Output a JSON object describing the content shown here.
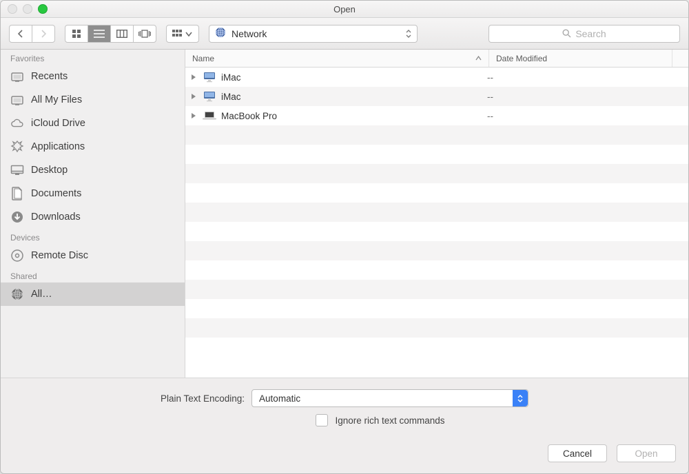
{
  "title": "Open",
  "toolbar": {
    "location_label": "Network",
    "search_placeholder": "Search"
  },
  "sidebar": {
    "groups": [
      {
        "label": "Favorites",
        "items": [
          {
            "icon": "recents-icon",
            "label": "Recents"
          },
          {
            "icon": "all-files-icon",
            "label": "All My Files"
          },
          {
            "icon": "icloud-icon",
            "label": "iCloud Drive"
          },
          {
            "icon": "applications-icon",
            "label": "Applications"
          },
          {
            "icon": "desktop-icon",
            "label": "Desktop"
          },
          {
            "icon": "documents-icon",
            "label": "Documents"
          },
          {
            "icon": "downloads-icon",
            "label": "Downloads"
          }
        ]
      },
      {
        "label": "Devices",
        "items": [
          {
            "icon": "remote-disc-icon",
            "label": "Remote Disc"
          }
        ]
      },
      {
        "label": "Shared",
        "items": [
          {
            "icon": "network-icon",
            "label": "All…",
            "active": true
          }
        ]
      }
    ]
  },
  "columns": {
    "name": "Name",
    "date": "Date Modified"
  },
  "rows": [
    {
      "icon": "imac",
      "name": "iMac",
      "date": "--"
    },
    {
      "icon": "imac",
      "name": "iMac",
      "date": "--"
    },
    {
      "icon": "macbook",
      "name": "MacBook Pro",
      "date": "--"
    }
  ],
  "options": {
    "encoding_label": "Plain Text Encoding:",
    "encoding_value": "Automatic",
    "ignore_label": "Ignore rich text commands"
  },
  "buttons": {
    "cancel": "Cancel",
    "open": "Open"
  }
}
